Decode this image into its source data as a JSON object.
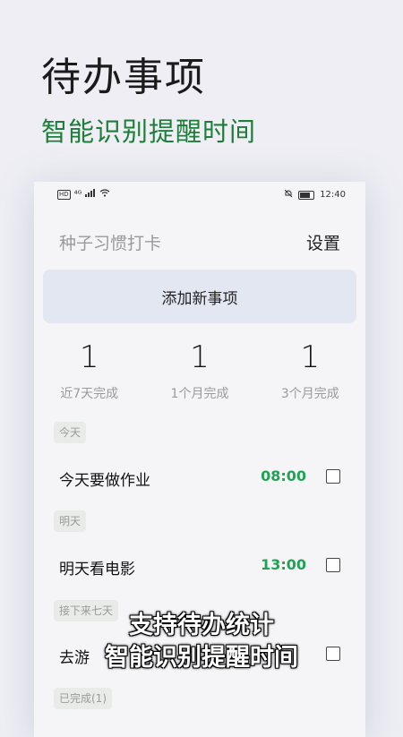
{
  "hero": {
    "title": "待办事项",
    "subtitle": "智能识别提醒时间"
  },
  "status_bar": {
    "left_icons": [
      "hd-icon",
      "signal-icon",
      "wifi-icon"
    ],
    "hd_label": "HD",
    "signal_label": "⁴ᴳ",
    "time": "12:40"
  },
  "appbar": {
    "title": "种子习惯打卡",
    "settings_label": "设置"
  },
  "add_button_label": "添加新事项",
  "stats": [
    {
      "value": "1",
      "label": "近7天完成"
    },
    {
      "value": "1",
      "label": "1个月完成"
    },
    {
      "value": "1",
      "label": "3个月完成"
    }
  ],
  "sections": {
    "today": "今天",
    "tomorrow": "明天",
    "next_week": "接下来七天",
    "completed": "已完成(1)"
  },
  "tasks": [
    {
      "name": "今天要做作业",
      "time": "08:00"
    },
    {
      "name": "明天看电影",
      "time": "13:00"
    },
    {
      "name": "去游",
      "time": ""
    }
  ],
  "caption": {
    "line1": "支持待办统计",
    "line2": "智能识别提醒时间"
  },
  "colors": {
    "accent_green": "#20a354",
    "subtitle_green": "#1f7d3a",
    "button_bg": "#e3e7f2"
  }
}
